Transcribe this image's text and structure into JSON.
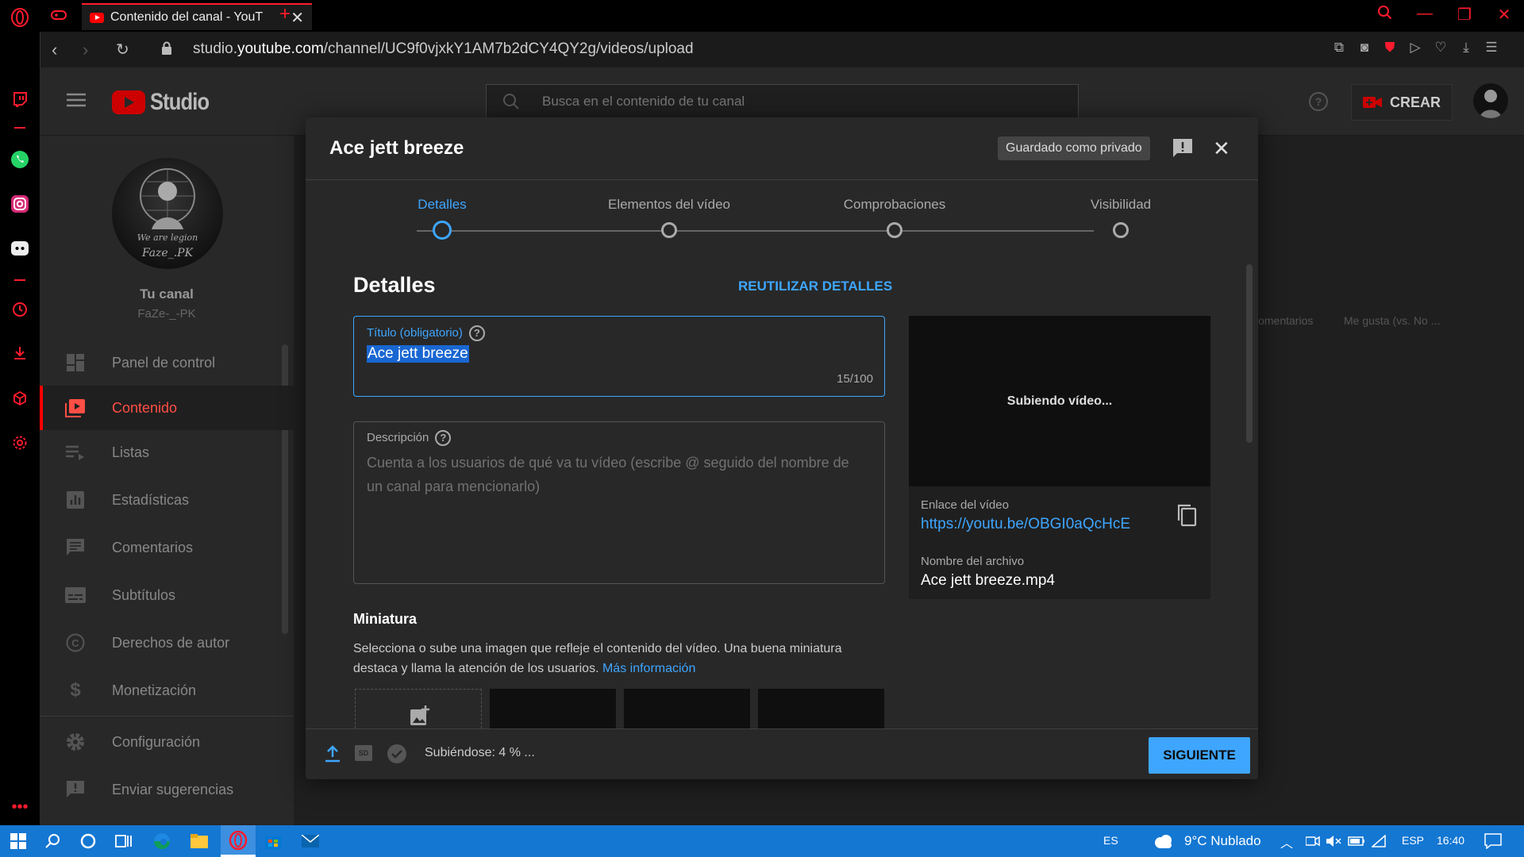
{
  "browser": {
    "tab_title": "Contenido del canal - YouT",
    "url_prefix": "studio.",
    "url_host": "youtube.com",
    "url_path": "/channel/UC9f0vjxkY1AM7b2dCY4QY2g/videos/upload"
  },
  "header": {
    "logo_text": "Studio",
    "search_placeholder": "Busca en el contenido de tu canal",
    "create_label": "CREAR"
  },
  "channel": {
    "avatar_line1": "We are legion",
    "avatar_line2": "Faze_.PK",
    "title": "Tu canal",
    "name": "FaZe-_-PK"
  },
  "sidebar": {
    "items": [
      {
        "label": "Panel de control",
        "icon": "dashboard-icon"
      },
      {
        "label": "Contenido",
        "icon": "content-icon"
      },
      {
        "label": "Listas",
        "icon": "playlists-icon"
      },
      {
        "label": "Estadísticas",
        "icon": "analytics-icon"
      },
      {
        "label": "Comentarios",
        "icon": "comments-icon"
      },
      {
        "label": "Subtítulos",
        "icon": "subtitles-icon"
      },
      {
        "label": "Derechos de autor",
        "icon": "copyright-icon"
      },
      {
        "label": "Monetización",
        "icon": "monetization-icon"
      },
      {
        "label": "Configuración",
        "icon": "settings-icon"
      },
      {
        "label": "Enviar sugerencias",
        "icon": "feedback-icon"
      }
    ]
  },
  "background_table": {
    "col_comments": "Comentarios",
    "col_likes": "Me gusta (vs. No ..."
  },
  "modal": {
    "title": "Ace jett breeze",
    "saved_badge": "Guardado como privado",
    "steps": [
      "Detalles",
      "Elementos del vídeo",
      "Comprobaciones",
      "Visibilidad"
    ],
    "section_title": "Detalles",
    "reuse_label": "REUTILIZAR DETALLES",
    "title_field": {
      "label": "Título (obligatorio)",
      "value": "Ace jett breeze",
      "counter": "15/100"
    },
    "description_field": {
      "label": "Descripción",
      "placeholder": "Cuenta a los usuarios de qué va tu vídeo (escribe @ seguido del nombre de un canal para mencionarlo)"
    },
    "thumbnail": {
      "title": "Miniatura",
      "text": "Selecciona o sube una imagen que refleje el contenido del vídeo. Una buena miniatura destaca y llama la atención de los usuarios.",
      "link": "Más información"
    },
    "preview": {
      "uploading": "Subiendo vídeo...",
      "link_label": "Enlace del vídeo",
      "link_value": "https://youtu.be/OBGI0aQcHcE",
      "filename_label": "Nombre del archivo",
      "filename_value": "Ace jett breeze.mp4"
    },
    "footer": {
      "status": "Subiéndose: 4 % ...",
      "sd_badge": "SD",
      "next_label": "SIGUIENTE"
    }
  },
  "taskbar": {
    "lang_indicator": "ES",
    "weather": "9°C  Nublado",
    "lang": "ESP",
    "time": "16:40"
  },
  "colors": {
    "opera_red": "#ff1b2d",
    "accent_blue": "#3ea6ff",
    "yt_red": "#ff0000",
    "taskbar": "#1477d2"
  }
}
